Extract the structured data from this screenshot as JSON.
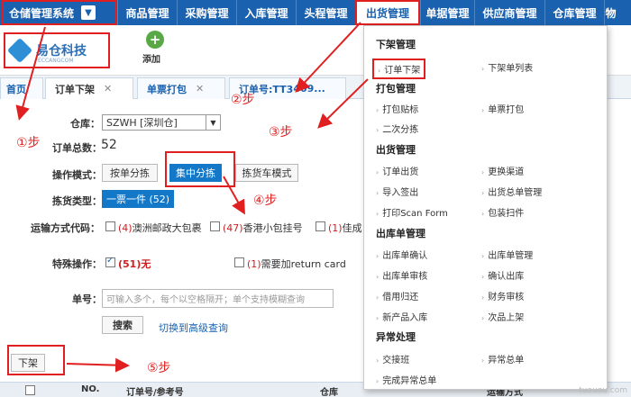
{
  "topnav": {
    "system_menu": "仓储管理系统",
    "items": [
      "商品管理",
      "采购管理",
      "入库管理",
      "头程管理",
      "出货管理",
      "单据管理",
      "供应商管理",
      "仓库管理",
      "物"
    ]
  },
  "toolbar": {
    "logo_name": "易仓科技",
    "logo_sub": "ECCANGCOM",
    "add_label": "添加"
  },
  "tabs": [
    "首页",
    "订单下架",
    "单票打包",
    "订单号:TT3",
    "409..."
  ],
  "form": {
    "warehouse_label": "仓库：",
    "warehouse_value": "SZWH [深圳仓]",
    "order_total_label": "订单总数：",
    "order_total_value": "52",
    "mode_label": "操作模式：",
    "mode_options": [
      "按单分拣",
      "集中分拣",
      "拣货车模式"
    ],
    "picking_type_label": "拣货类型：",
    "picking_type_value": "一票一件 (52)",
    "shipping_label": "运输方式代码：",
    "shipping_options": [
      {
        "count": "(4)",
        "name": "澳洲邮政大包裹"
      },
      {
        "count": "(47)",
        "name": "香港小包挂号"
      },
      {
        "count": "(1)",
        "name": "佳成"
      }
    ],
    "special_label": "特殊操作：",
    "special_options": [
      {
        "count": "(51)",
        "name": "无",
        "checked": true
      },
      {
        "count": "(1)",
        "name": "需要加return card",
        "checked": false
      }
    ],
    "order_no_label": "单号：",
    "order_no_placeholder": "可输入多个，每个以空格隔开；单个支持模糊查询",
    "search_btn": "搜索",
    "advanced_link": "切换到高级查询"
  },
  "action": {
    "down_btn": "下架"
  },
  "table_headers": [
    "NO.",
    "订单号/参考号",
    "仓库",
    "运输方式"
  ],
  "dropdown": {
    "sections": [
      {
        "title": "下架管理",
        "items": [
          "订单下架",
          "下架单列表"
        ]
      },
      {
        "title": "打包管理",
        "items": [
          "打包贴标",
          "单票打包",
          "二次分拣"
        ]
      },
      {
        "title": "出货管理",
        "items": [
          "订单出货",
          "更换渠道",
          "导入签出",
          "出货总单管理",
          "打印Scan Form",
          "包装扫件"
        ]
      },
      {
        "title": "出库单管理",
        "items": [
          "出库单确认",
          "出库单管理",
          "出库单审核",
          "确认出库",
          "借用归还",
          "财务审核",
          "新产品入库",
          "次品上架"
        ]
      },
      {
        "title": "异常处理",
        "items": [
          "交接班",
          "异常总单",
          "完成异常总单"
        ]
      }
    ]
  },
  "steps": [
    "①步",
    "②步",
    "③步",
    "④步",
    "⑤步"
  ],
  "watermark": "tuauou.com"
}
